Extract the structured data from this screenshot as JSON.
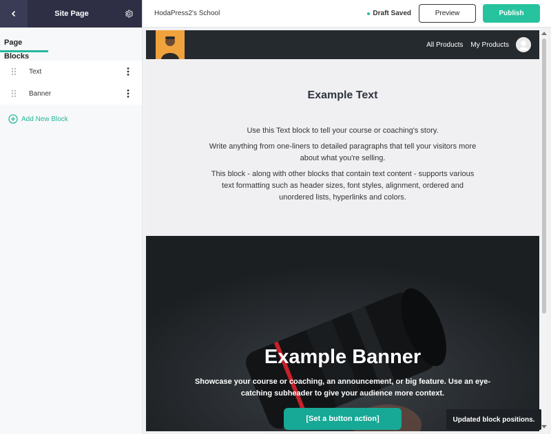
{
  "sidebar": {
    "title": "Site Page",
    "tab": "Page Blocks",
    "blocks": [
      {
        "label": "Text"
      },
      {
        "label": "Banner"
      }
    ],
    "add_block": "Add New Block"
  },
  "topbar": {
    "school_name": "HodaPress2's School",
    "status": "Draft Saved",
    "preview_label": "Preview",
    "publish_label": "Publish"
  },
  "preview": {
    "nav": {
      "links": [
        "All Products",
        "My Products"
      ]
    },
    "text_block": {
      "title": "Example Text",
      "paragraphs": [
        "Use this Text block to tell your course or coaching's story.",
        "Write anything from one-liners to detailed paragraphs that tell your visitors more about what you're selling.",
        "This block - along with other blocks that contain text content - supports various text formatting such as header sizes, font styles, alignment, ordered and unordered lists, hyperlinks and colors."
      ]
    },
    "banner": {
      "title": "Example Banner",
      "subtitle": "Showcase your course or coaching, an announcement, or big feature. Use an eye-catching subheader to give your audience more context.",
      "button_label": "[Set a button action]"
    }
  },
  "toast": "Updated block positions.",
  "colors": {
    "accent": "#27c39e",
    "sidebar_header": "#2e2f45",
    "site_nav": "#252a2e",
    "banner_button": "#17a896"
  }
}
